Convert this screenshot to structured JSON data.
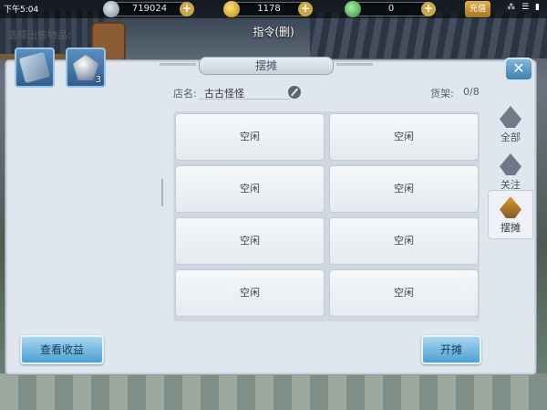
{
  "status_bar": {
    "time": "下午5:04",
    "system_icons": "⁂ ☰ ▮"
  },
  "resources": {
    "silver": "719024",
    "gold": "1178",
    "jade": "0",
    "recharge_label": "充值"
  },
  "command_title": "指令(删)",
  "panel": {
    "title": "摆摊",
    "close_label": "✕",
    "select_items_label": "选择出售物品:",
    "items": [
      {
        "name": "scroll-item",
        "count": ""
      },
      {
        "name": "crystal-item",
        "count": "3"
      }
    ],
    "shop_label": "店名:",
    "shop_name": "古古怪怪",
    "shelf_label": "货架:",
    "shelf_count": "0/8",
    "slots": [
      "空闲",
      "空闲",
      "空闲",
      "空闲",
      "空闲",
      "空闲",
      "空闲",
      "空闲"
    ],
    "tabs": [
      {
        "label": "全部",
        "active": false
      },
      {
        "label": "关注",
        "active": false
      },
      {
        "label": "摆摊",
        "active": true
      }
    ],
    "view_income_label": "查看收益",
    "open_stall_label": "开摊"
  }
}
